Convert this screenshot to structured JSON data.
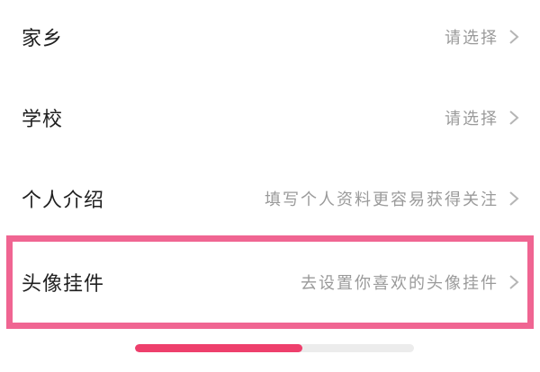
{
  "rows": [
    {
      "label": "家乡",
      "value": "请选择"
    },
    {
      "label": "学校",
      "value": "请选择"
    },
    {
      "label": "个人介绍",
      "value": "填写个人资料更容易获得关注"
    },
    {
      "label": "头像挂件",
      "value": "去设置你喜欢的头像挂件"
    }
  ],
  "highlight_color": "#f06592",
  "progress": {
    "fraction": 0.6,
    "fill_color": "#ee3f6c",
    "track_color": "#ececec"
  },
  "icons": {
    "chevron": "chevron-right-icon"
  }
}
